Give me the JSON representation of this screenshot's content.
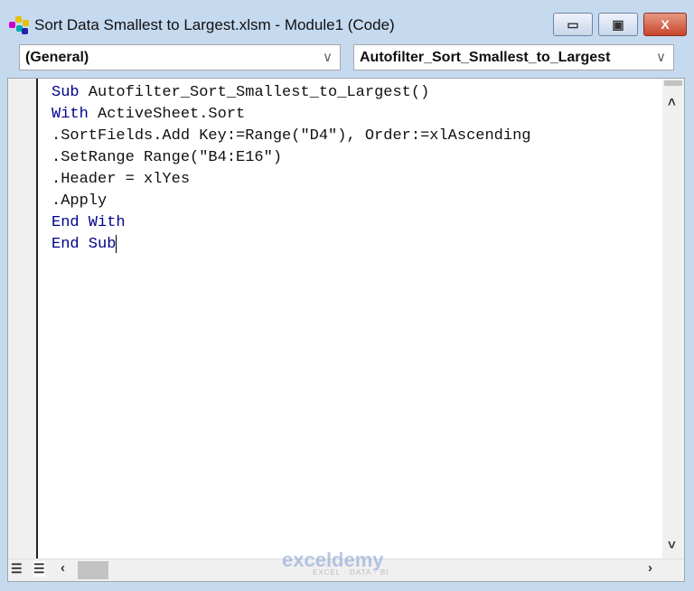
{
  "window": {
    "title": "Sort Data Smallest to Largest.xlsm - Module1 (Code)",
    "minimize": "▭",
    "restore": "▣",
    "close": "X"
  },
  "dropdowns": {
    "object": "(General)",
    "procedure": "Autofilter_Sort_Smallest_to_Largest",
    "chevron": "∨"
  },
  "code": [
    {
      "kw": "Sub",
      "rest": " Autofilter_Sort_Smallest_to_Largest()"
    },
    {
      "kw": "With",
      "rest": " ActiveSheet.Sort"
    },
    {
      "kw": "",
      "rest": ".SortFields.Add Key:=Range(\"D4\"), Order:=xlAscending"
    },
    {
      "kw": "",
      "rest": ".SetRange Range(\"B4:E16\")"
    },
    {
      "kw": "",
      "rest": ".Header = xlYes"
    },
    {
      "kw": "",
      "rest": ".Apply"
    },
    {
      "kw": "End With",
      "rest": ""
    },
    {
      "kw": "End Sub",
      "rest": ""
    }
  ],
  "watermark": {
    "brand": "exceldemy",
    "tagline": "EXCEL · DATA · BI"
  },
  "colors": {
    "keyword": "#00008b",
    "frame": "#c5d9ef"
  }
}
